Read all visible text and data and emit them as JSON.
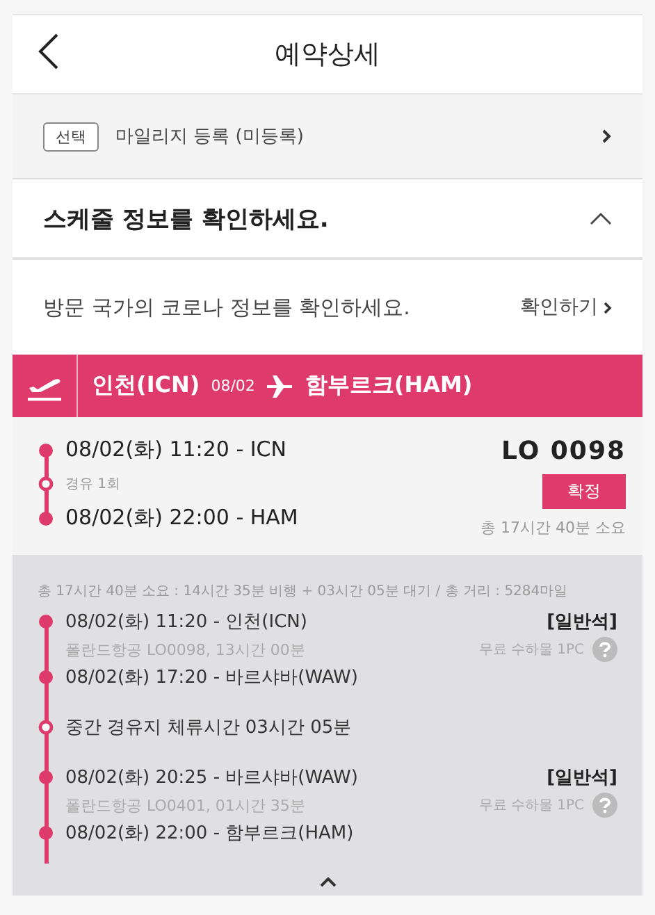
{
  "header": {
    "title": "예약상세"
  },
  "mileage": {
    "tag": "선택",
    "label": "마일리지 등록 (미등록)"
  },
  "schedule": {
    "title": "스케줄 정보를 확인하세요.",
    "expanded": true
  },
  "corona": {
    "text": "방문 국가의 코로나 정보를 확인하세요.",
    "link": "확인하기"
  },
  "route": {
    "from": "인천(ICN)",
    "date": "08/02",
    "to": "함부르크(HAM)"
  },
  "summary": {
    "depart": "08/02(화) 11:20 - ICN",
    "stops": "경유 1회",
    "arrive": "08/02(화) 22:00 - HAM",
    "flight": "LO 0098",
    "status": "확정",
    "duration": "총 17시간 40분 소요"
  },
  "details": {
    "summary": "총 17시간 40분 소요 : 14시간 35분 비행 + 03시간 05분 대기 / 총 거리 : 5284마일",
    "expanded": true,
    "items": [
      {
        "kind": "segment",
        "depart": "08/02(화) 11:20 - 인천(ICN)",
        "cabin": "[일반석]",
        "info": "폴란드항공 LO0098, 13시간 00분",
        "baggage": "무료 수하물 1PC",
        "arrive": "08/02(화) 17:20 - 바르샤바(WAW)"
      },
      {
        "kind": "layover",
        "text": "중간 경유지 체류시간 03시간 05분"
      },
      {
        "kind": "segment",
        "depart": "08/02(화) 20:25 - 바르샤바(WAW)",
        "cabin": "[일반석]",
        "info": "폴란드항공 LO0401, 01시간 35분",
        "baggage": "무료 수하물 1PC",
        "arrive": "08/02(화) 22:00 - 함부르크(HAM)"
      }
    ]
  }
}
